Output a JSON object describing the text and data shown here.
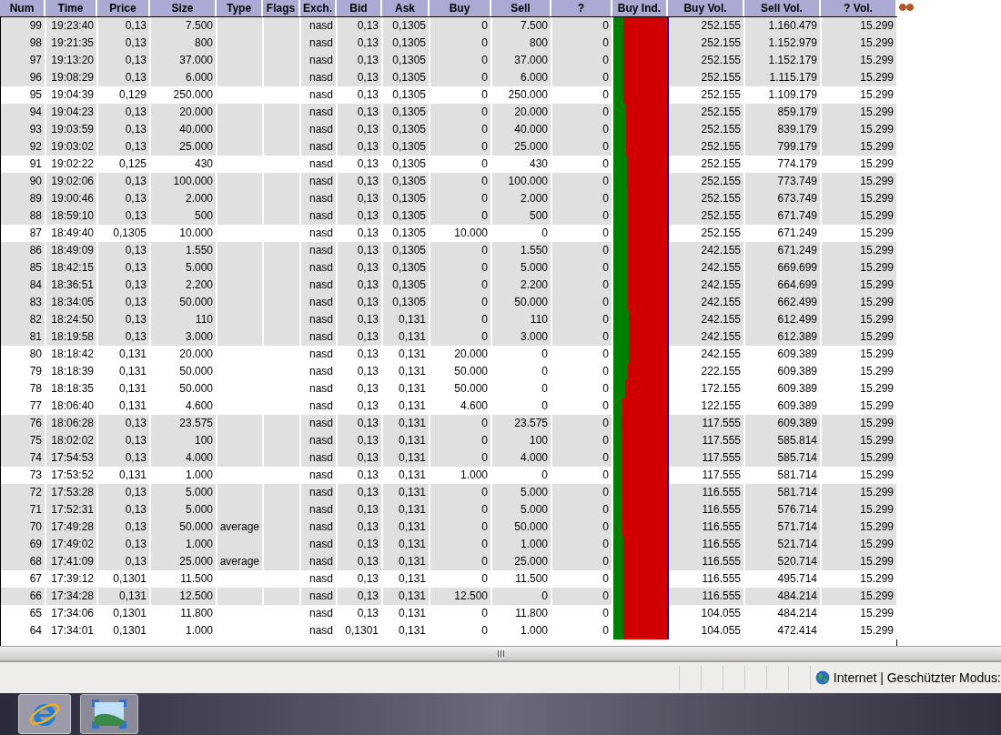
{
  "table": {
    "columns": [
      {
        "label": "Num",
        "kind": "value"
      },
      {
        "label": "Time",
        "kind": "value"
      },
      {
        "label": "Price",
        "kind": "value"
      },
      {
        "label": "Size",
        "kind": "value"
      },
      {
        "label": "Type",
        "kind": "value"
      },
      {
        "label": "Flags",
        "kind": "value"
      },
      {
        "label": "Exch.",
        "kind": "value"
      },
      {
        "label": "Bid",
        "kind": "value"
      },
      {
        "label": "Ask",
        "kind": "value"
      },
      {
        "label": "Buy",
        "kind": "value"
      },
      {
        "label": "Sell",
        "kind": "value"
      },
      {
        "label": "?",
        "kind": "value"
      },
      {
        "label": "Buy Ind.",
        "kind": "indicator"
      },
      {
        "label": "Buy Vol.",
        "kind": "value"
      },
      {
        "label": "Sell Vol.",
        "kind": "value"
      },
      {
        "label": "? Vol.",
        "kind": "value"
      }
    ],
    "rows": [
      {
        "shaded": true,
        "num": "99",
        "time": "19:23:40",
        "price": "0,13",
        "size": "7.500",
        "exch": "nasd",
        "bid": "0,13",
        "ask": "0,1305",
        "buy": "0",
        "sell": "7.500",
        "q": "0",
        "level": 0.18,
        "buy_vol": "252.155",
        "sell_vol": "1.160.479",
        "q_vol": "15.299"
      },
      {
        "shaded": true,
        "num": "98",
        "time": "19:21:35",
        "price": "0,13",
        "size": "800",
        "exch": "nasd",
        "bid": "0,13",
        "ask": "0,1305",
        "buy": "0",
        "sell": "800",
        "q": "0",
        "level": 0.18,
        "buy_vol": "252.155",
        "sell_vol": "1.152.979",
        "q_vol": "15.299"
      },
      {
        "shaded": true,
        "num": "97",
        "time": "19:13:20",
        "price": "0,13",
        "size": "37.000",
        "exch": "nasd",
        "bid": "0,13",
        "ask": "0,1305",
        "buy": "0",
        "sell": "37.000",
        "q": "0",
        "level": 0.18,
        "buy_vol": "252.155",
        "sell_vol": "1.152.179",
        "q_vol": "15.299"
      },
      {
        "shaded": true,
        "num": "96",
        "time": "19:08:29",
        "price": "0,13",
        "size": "6.000",
        "exch": "nasd",
        "bid": "0,13",
        "ask": "0,1305",
        "buy": "0",
        "sell": "6.000",
        "q": "0",
        "level": 0.18,
        "buy_vol": "252.155",
        "sell_vol": "1.115.179",
        "q_vol": "15.299"
      },
      {
        "shaded": false,
        "num": "95",
        "time": "19:04:39",
        "price": "0,129",
        "size": "250.000",
        "exch": "nasd",
        "bid": "0,13",
        "ask": "0,1305",
        "buy": "0",
        "sell": "250.000",
        "q": "0",
        "level": 0.19,
        "buy_vol": "252.155",
        "sell_vol": "1.109.179",
        "q_vol": "15.299"
      },
      {
        "shaded": true,
        "num": "94",
        "time": "19:04:23",
        "price": "0,13",
        "size": "20.000",
        "exch": "nasd",
        "bid": "0,13",
        "ask": "0,1305",
        "buy": "0",
        "sell": "20.000",
        "q": "0",
        "level": 0.23,
        "buy_vol": "252.155",
        "sell_vol": "859.179",
        "q_vol": "15.299"
      },
      {
        "shaded": true,
        "num": "93",
        "time": "19:03:59",
        "price": "0,13",
        "size": "40.000",
        "exch": "nasd",
        "bid": "0,13",
        "ask": "0,1305",
        "buy": "0",
        "sell": "40.000",
        "q": "0",
        "level": 0.23,
        "buy_vol": "252.155",
        "sell_vol": "839.179",
        "q_vol": "15.299"
      },
      {
        "shaded": true,
        "num": "92",
        "time": "19:03:02",
        "price": "0,13",
        "size": "25.000",
        "exch": "nasd",
        "bid": "0,13",
        "ask": "0,1305",
        "buy": "0",
        "sell": "25.000",
        "q": "0",
        "level": 0.24,
        "buy_vol": "252.155",
        "sell_vol": "799.179",
        "q_vol": "15.299"
      },
      {
        "shaded": false,
        "num": "91",
        "time": "19:02:22",
        "price": "0,125",
        "size": "430",
        "exch": "nasd",
        "bid": "0,13",
        "ask": "0,1305",
        "buy": "0",
        "sell": "430",
        "q": "0",
        "level": 0.25,
        "buy_vol": "252.155",
        "sell_vol": "774.179",
        "q_vol": "15.299"
      },
      {
        "shaded": true,
        "num": "90",
        "time": "19:02:06",
        "price": "0,13",
        "size": "100.000",
        "exch": "nasd",
        "bid": "0,13",
        "ask": "0,1305",
        "buy": "0",
        "sell": "100.000",
        "q": "0",
        "level": 0.25,
        "buy_vol": "252.155",
        "sell_vol": "773.749",
        "q_vol": "15.299"
      },
      {
        "shaded": true,
        "num": "89",
        "time": "19:00:46",
        "price": "0,13",
        "size": "2.000",
        "exch": "nasd",
        "bid": "0,13",
        "ask": "0,1305",
        "buy": "0",
        "sell": "2.000",
        "q": "0",
        "level": 0.27,
        "buy_vol": "252.155",
        "sell_vol": "673.749",
        "q_vol": "15.299"
      },
      {
        "shaded": true,
        "num": "88",
        "time": "18:59:10",
        "price": "0,13",
        "size": "500",
        "exch": "nasd",
        "bid": "0,13",
        "ask": "0,1305",
        "buy": "0",
        "sell": "500",
        "q": "0",
        "level": 0.27,
        "buy_vol": "252.155",
        "sell_vol": "671.749",
        "q_vol": "15.299"
      },
      {
        "shaded": false,
        "num": "87",
        "time": "18:49:40",
        "price": "0,1305",
        "size": "10.000",
        "exch": "nasd",
        "bid": "0,13",
        "ask": "0,1305",
        "buy": "10.000",
        "sell": "0",
        "q": "0",
        "level": 0.27,
        "buy_vol": "252.155",
        "sell_vol": "671.249",
        "q_vol": "15.299"
      },
      {
        "shaded": true,
        "num": "86",
        "time": "18:49:09",
        "price": "0,13",
        "size": "1.550",
        "exch": "nasd",
        "bid": "0,13",
        "ask": "0,1305",
        "buy": "0",
        "sell": "1.550",
        "q": "0",
        "level": 0.27,
        "buy_vol": "242.155",
        "sell_vol": "671.249",
        "q_vol": "15.299"
      },
      {
        "shaded": true,
        "num": "85",
        "time": "18:42:15",
        "price": "0,13",
        "size": "5.000",
        "exch": "nasd",
        "bid": "0,13",
        "ask": "0,1305",
        "buy": "0",
        "sell": "5.000",
        "q": "0",
        "level": 0.27,
        "buy_vol": "242.155",
        "sell_vol": "669.699",
        "q_vol": "15.299"
      },
      {
        "shaded": true,
        "num": "84",
        "time": "18:36:51",
        "price": "0,13",
        "size": "2.200",
        "exch": "nasd",
        "bid": "0,13",
        "ask": "0,1305",
        "buy": "0",
        "sell": "2.200",
        "q": "0",
        "level": 0.27,
        "buy_vol": "242.155",
        "sell_vol": "664.699",
        "q_vol": "15.299"
      },
      {
        "shaded": true,
        "num": "83",
        "time": "18:34:05",
        "price": "0,13",
        "size": "50.000",
        "exch": "nasd",
        "bid": "0,13",
        "ask": "0,1305",
        "buy": "0",
        "sell": "50.000",
        "q": "0",
        "level": 0.27,
        "buy_vol": "242.155",
        "sell_vol": "662.499",
        "q_vol": "15.299"
      },
      {
        "shaded": true,
        "num": "82",
        "time": "18:24:50",
        "price": "0,13",
        "size": "110",
        "exch": "nasd",
        "bid": "0,13",
        "ask": "0,131",
        "buy": "0",
        "sell": "110",
        "q": "0",
        "level": 0.28,
        "buy_vol": "242.155",
        "sell_vol": "612.499",
        "q_vol": "15.299"
      },
      {
        "shaded": true,
        "num": "81",
        "time": "18:19:58",
        "price": "0,13",
        "size": "3.000",
        "exch": "nasd",
        "bid": "0,13",
        "ask": "0,131",
        "buy": "0",
        "sell": "3.000",
        "q": "0",
        "level": 0.28,
        "buy_vol": "242.155",
        "sell_vol": "612.389",
        "q_vol": "15.299"
      },
      {
        "shaded": false,
        "num": "80",
        "time": "18:18:42",
        "price": "0,131",
        "size": "20.000",
        "exch": "nasd",
        "bid": "0,13",
        "ask": "0,131",
        "buy": "20.000",
        "sell": "0",
        "q": "0",
        "level": 0.28,
        "buy_vol": "242.155",
        "sell_vol": "609.389",
        "q_vol": "15.299"
      },
      {
        "shaded": false,
        "num": "79",
        "time": "18:18:39",
        "price": "0,131",
        "size": "50.000",
        "exch": "nasd",
        "bid": "0,13",
        "ask": "0,131",
        "buy": "50.000",
        "sell": "0",
        "q": "0",
        "level": 0.27,
        "buy_vol": "222.155",
        "sell_vol": "609.389",
        "q_vol": "15.299"
      },
      {
        "shaded": false,
        "num": "78",
        "time": "18:18:35",
        "price": "0,131",
        "size": "50.000",
        "exch": "nasd",
        "bid": "0,13",
        "ask": "0,131",
        "buy": "50.000",
        "sell": "0",
        "q": "0",
        "level": 0.22,
        "buy_vol": "172.155",
        "sell_vol": "609.389",
        "q_vol": "15.299"
      },
      {
        "shaded": false,
        "num": "77",
        "time": "18:06:40",
        "price": "0,131",
        "size": "4.600",
        "exch": "nasd",
        "bid": "0,13",
        "ask": "0,131",
        "buy": "4.600",
        "sell": "0",
        "q": "0",
        "level": 0.17,
        "buy_vol": "122.155",
        "sell_vol": "609.389",
        "q_vol": "15.299"
      },
      {
        "shaded": true,
        "num": "76",
        "time": "18:06:28",
        "price": "0,13",
        "size": "23.575",
        "exch": "nasd",
        "bid": "0,13",
        "ask": "0,131",
        "buy": "0",
        "sell": "23.575",
        "q": "0",
        "level": 0.16,
        "buy_vol": "117.555",
        "sell_vol": "609.389",
        "q_vol": "15.299"
      },
      {
        "shaded": true,
        "num": "75",
        "time": "18:02:02",
        "price": "0,13",
        "size": "100",
        "exch": "nasd",
        "bid": "0,13",
        "ask": "0,131",
        "buy": "0",
        "sell": "100",
        "q": "0",
        "level": 0.17,
        "buy_vol": "117.555",
        "sell_vol": "585.814",
        "q_vol": "15.299"
      },
      {
        "shaded": true,
        "num": "74",
        "time": "17:54:53",
        "price": "0,13",
        "size": "4.000",
        "exch": "nasd",
        "bid": "0,13",
        "ask": "0,131",
        "buy": "0",
        "sell": "4.000",
        "q": "0",
        "level": 0.17,
        "buy_vol": "117.555",
        "sell_vol": "585.714",
        "q_vol": "15.299"
      },
      {
        "shaded": false,
        "num": "73",
        "time": "17:53:52",
        "price": "0,131",
        "size": "1.000",
        "exch": "nasd",
        "bid": "0,13",
        "ask": "0,131",
        "buy": "1.000",
        "sell": "0",
        "q": "0",
        "level": 0.17,
        "buy_vol": "117.555",
        "sell_vol": "581.714",
        "q_vol": "15.299"
      },
      {
        "shaded": true,
        "num": "72",
        "time": "17:53:28",
        "price": "0,13",
        "size": "5.000",
        "exch": "nasd",
        "bid": "0,13",
        "ask": "0,131",
        "buy": "0",
        "sell": "5.000",
        "q": "0",
        "level": 0.17,
        "buy_vol": "116.555",
        "sell_vol": "581.714",
        "q_vol": "15.299"
      },
      {
        "shaded": true,
        "num": "71",
        "time": "17:52:31",
        "price": "0,13",
        "size": "5.000",
        "exch": "nasd",
        "bid": "0,13",
        "ask": "0,131",
        "buy": "0",
        "sell": "5.000",
        "q": "0",
        "level": 0.17,
        "buy_vol": "116.555",
        "sell_vol": "576.714",
        "q_vol": "15.299"
      },
      {
        "shaded": true,
        "num": "70",
        "time": "17:49:28",
        "price": "0,13",
        "size": "50.000",
        "type": "average",
        "exch": "nasd",
        "bid": "0,13",
        "ask": "0,131",
        "buy": "0",
        "sell": "50.000",
        "q": "0",
        "level": 0.17,
        "buy_vol": "116.555",
        "sell_vol": "571.714",
        "q_vol": "15.299"
      },
      {
        "shaded": true,
        "num": "69",
        "time": "17:49:02",
        "price": "0,13",
        "size": "1.000",
        "exch": "nasd",
        "bid": "0,13",
        "ask": "0,131",
        "buy": "0",
        "sell": "1.000",
        "q": "0",
        "level": 0.18,
        "buy_vol": "116.555",
        "sell_vol": "521.714",
        "q_vol": "15.299"
      },
      {
        "shaded": true,
        "num": "68",
        "time": "17:41:09",
        "price": "0,13",
        "size": "25.000",
        "type": "average",
        "exch": "nasd",
        "bid": "0,13",
        "ask": "0,131",
        "buy": "0",
        "sell": "25.000",
        "q": "0",
        "level": 0.18,
        "buy_vol": "116.555",
        "sell_vol": "520.714",
        "q_vol": "15.299"
      },
      {
        "shaded": false,
        "num": "67",
        "time": "17:39:12",
        "price": "0,1301",
        "size": "11.500",
        "exch": "nasd",
        "bid": "0,13",
        "ask": "0,131",
        "buy": "0",
        "sell": "11.500",
        "q": "0",
        "level": 0.19,
        "buy_vol": "116.555",
        "sell_vol": "495.714",
        "q_vol": "15.299"
      },
      {
        "shaded": true,
        "num": "66",
        "time": "17:34:28",
        "price": "0,131",
        "size": "12.500",
        "exch": "nasd",
        "bid": "0,13",
        "ask": "0,131",
        "buy": "12.500",
        "sell": "0",
        "q": "0",
        "level": 0.19,
        "buy_vol": "116.555",
        "sell_vol": "484.214",
        "q_vol": "15.299"
      },
      {
        "shaded": false,
        "num": "65",
        "time": "17:34:06",
        "price": "0,1301",
        "size": "11.800",
        "exch": "nasd",
        "bid": "0,13",
        "ask": "0,131",
        "buy": "0",
        "sell": "11.800",
        "q": "0",
        "level": 0.18,
        "buy_vol": "104.055",
        "sell_vol": "484.214",
        "q_vol": "15.299"
      },
      {
        "shaded": false,
        "num": "64",
        "time": "17:34:01",
        "price": "0,1301",
        "size": "1.000",
        "exch": "nasd",
        "bid": "0,1301",
        "ask": "0,131",
        "buy": "0",
        "sell": "1.000",
        "q": "0",
        "level": 0.18,
        "buy_vol": "104.055",
        "sell_vol": "472.414",
        "q_vol": "15.299"
      }
    ]
  },
  "status_bar": {
    "zone": "Internet | Geschützter Modus:"
  }
}
